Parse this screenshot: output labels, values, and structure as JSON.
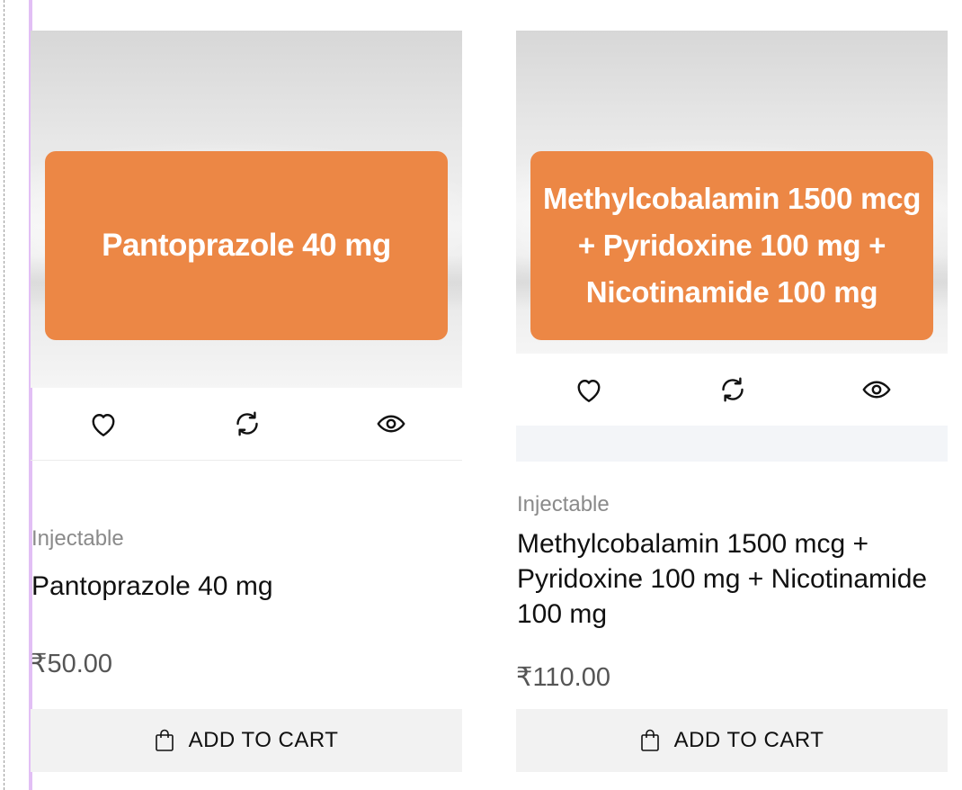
{
  "products": [
    {
      "image_text": "Pantoprazole 40 mg",
      "category": "Injectable",
      "name": "Pantoprazole 40 mg",
      "price": "₹50.00",
      "add_to_cart_label": "ADD TO CART"
    },
    {
      "image_text": "Methylcobalamin 1500 mcg + Pyridoxine 100 mg + Nicotinamide 100 mg",
      "category": "Injectable",
      "name": "Methylcobalamin 1500 mcg + Pyridoxine 100 mg + Nicotinamide 100 mg",
      "price": "₹110.00",
      "add_to_cart_label": "ADD TO CART"
    }
  ],
  "icons": {
    "wishlist": "heart-icon",
    "compare": "refresh-icon",
    "quick_view": "eye-icon",
    "cart": "shopping-bag-icon"
  },
  "colors": {
    "accent_orange": "#ec8745",
    "button_bg": "#f2f2f2",
    "category_text": "#8a8a8a",
    "price_text": "#555555"
  }
}
